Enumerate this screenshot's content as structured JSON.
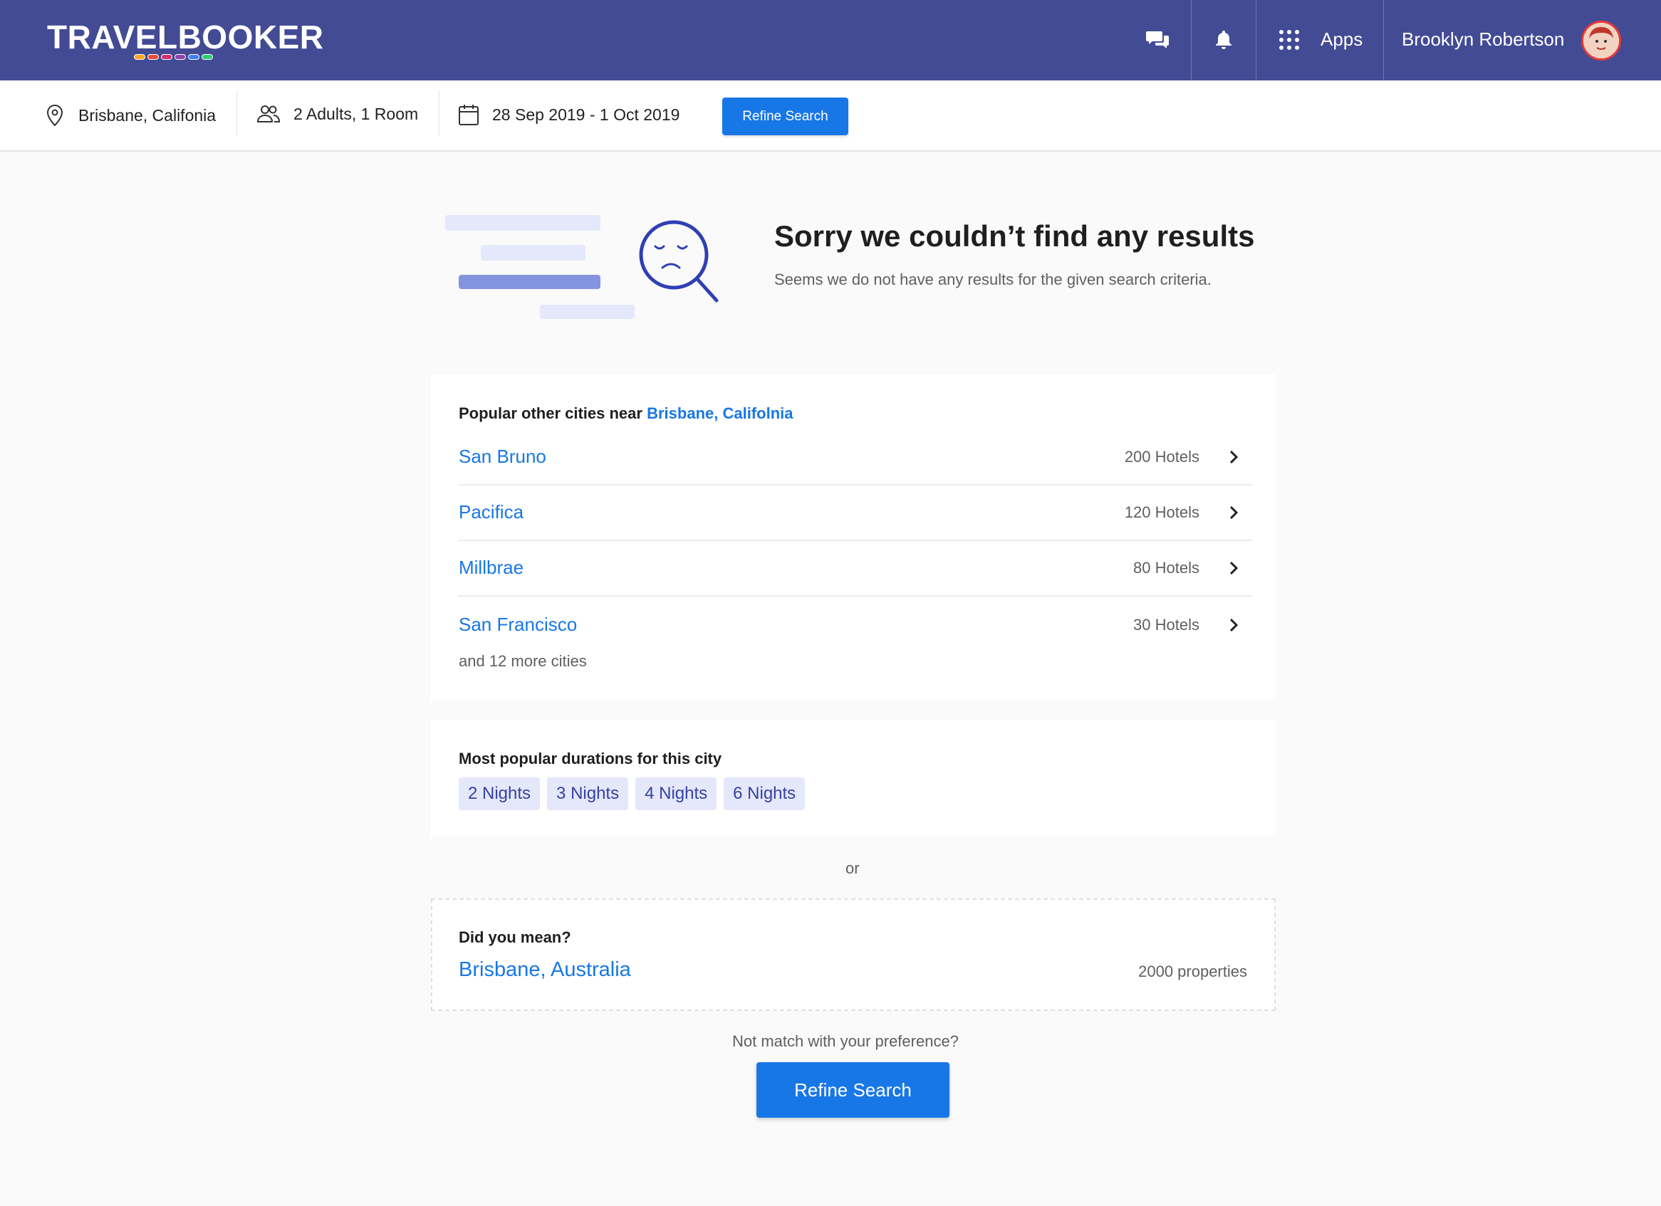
{
  "header": {
    "logo_text": "TRAVELBOOKER",
    "apps_label": "Apps",
    "user_name": "Brooklyn Robertson",
    "icons": [
      "chat-icon",
      "bell-icon",
      "apps-grid-icon"
    ],
    "background_color": "#434b94"
  },
  "search": {
    "location": "Brisbane, Califonia",
    "guests": "2 Adults, 1 Room",
    "dates": "28 Sep 2019 - 1 Oct 2019",
    "refine_label": "Refine Search"
  },
  "empty_state": {
    "heading": "Sorry we couldn’t find any results",
    "subtext": "Seems we do not have any results for the given search criteria."
  },
  "cities": {
    "title_prefix": "Popular other cities near",
    "title_link": "Brisbane, Califolnia",
    "items": [
      {
        "name": "San Bruno",
        "count": "200 Hotels"
      },
      {
        "name": "Pacifica",
        "count": "120 Hotels"
      },
      {
        "name": "Millbrae",
        "count": "80 Hotels"
      },
      {
        "name": "San Francisco",
        "count": "30 Hotels"
      }
    ],
    "more_text": "and 12 more cities"
  },
  "durations": {
    "title": "Most popular durations for this city",
    "chips": [
      "2 Nights",
      "3 Nights",
      "4 Nights",
      "6 Nights"
    ]
  },
  "or_text": "or",
  "did_you_mean": {
    "title": "Did you mean?",
    "city": "Brisbane, Australia",
    "count": "2000 properties"
  },
  "footer": {
    "prompt": "Not match with your preference?",
    "refine_label": "Refine Search"
  },
  "colors": {
    "accent": "#1877e6",
    "chip_bg": "#e5e7fa",
    "chip_text": "#3442a3"
  }
}
